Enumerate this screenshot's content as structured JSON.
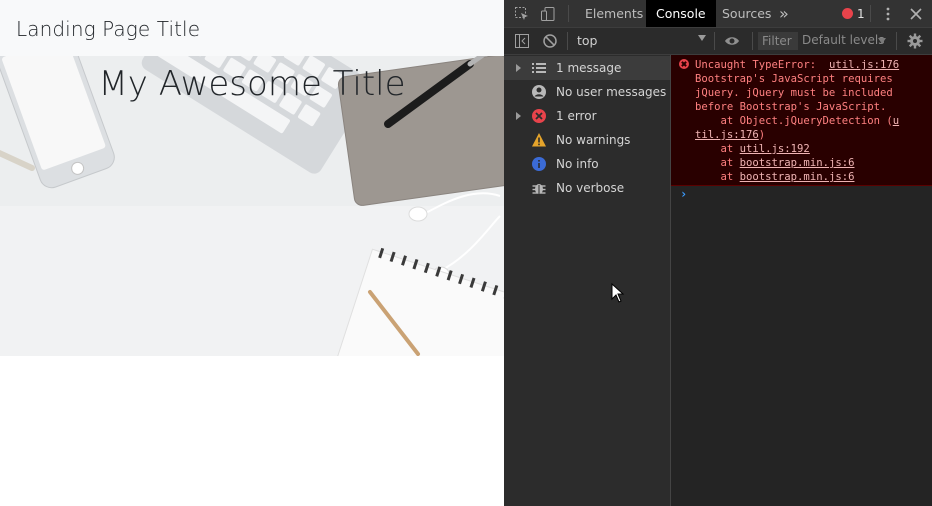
{
  "page": {
    "brand": "Landing Page Title",
    "hero_title": "My Awesome Title"
  },
  "devtools": {
    "tabs": [
      {
        "label": "Elements",
        "active": false
      },
      {
        "label": "Console",
        "active": true
      },
      {
        "label": "Sources",
        "active": false
      }
    ],
    "more_tabs": "»",
    "error_badge_count": "1",
    "context": "top",
    "filter_placeholder": "Filter",
    "levels": "Default levels",
    "sidebar": [
      {
        "label": "1 message",
        "icon": "list-icon",
        "expandable": true,
        "selected": true
      },
      {
        "label": "No user messages",
        "icon": "user-icon",
        "expandable": false,
        "selected": false
      },
      {
        "label": "1 error",
        "icon": "error-icon",
        "expandable": true,
        "selected": false
      },
      {
        "label": "No warnings",
        "icon": "warning-icon",
        "expandable": false,
        "selected": false
      },
      {
        "label": "No info",
        "icon": "info-icon",
        "expandable": false,
        "selected": false
      },
      {
        "label": "No verbose",
        "icon": "bug-icon",
        "expandable": false,
        "selected": false
      }
    ],
    "error": {
      "message_line1": "Uncaught TypeError:",
      "source_link": "util.js:176",
      "message_rest": "Bootstrap's JavaScript requires\njQuery. jQuery must be included\nbefore Bootstrap's JavaScript.",
      "stack": [
        {
          "prefix": "    at Object.jQueryDetection (",
          "link": "util.js:176",
          "suffix": ")"
        },
        {
          "prefix": "    at ",
          "link": "util.js:192",
          "suffix": ""
        },
        {
          "prefix": "    at ",
          "link": "bootstrap.min.js:6",
          "suffix": ""
        },
        {
          "prefix": "    at ",
          "link": "bootstrap.min.js:6",
          "suffix": ""
        }
      ]
    },
    "prompt": "›",
    "colors": {
      "error_bg": "#290000",
      "error_text": "#ff8080",
      "active_tab_bg": "#000000",
      "panel_bg": "#242424",
      "prompt": "#3b9cff"
    }
  }
}
